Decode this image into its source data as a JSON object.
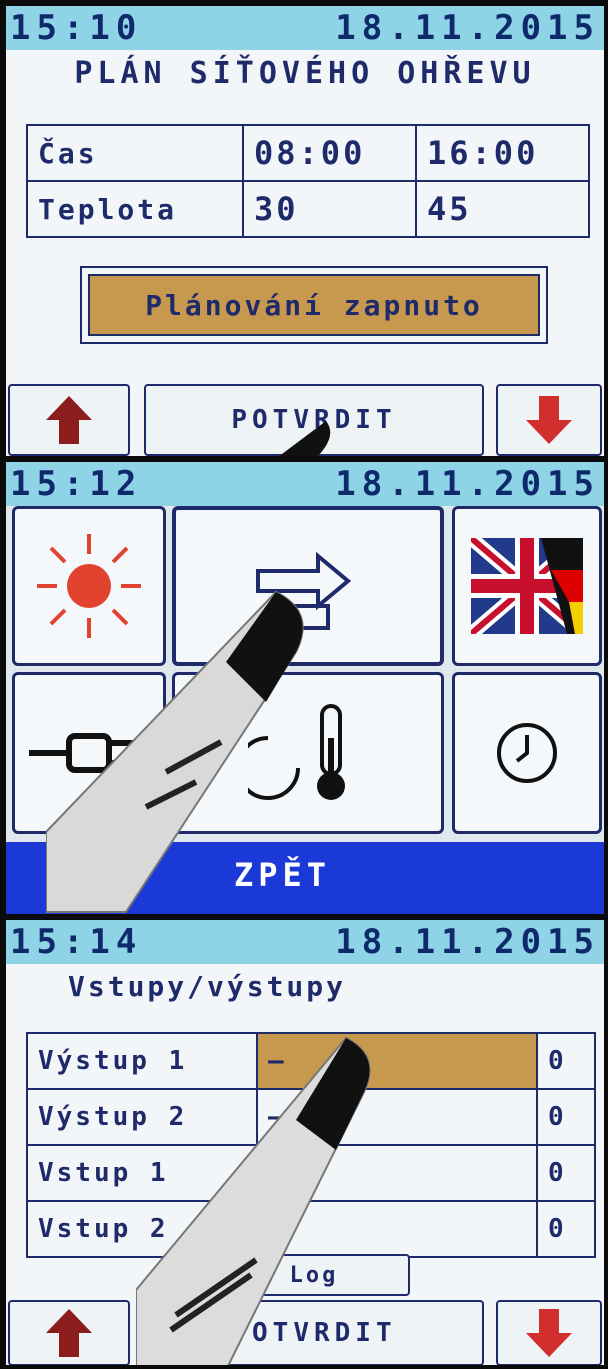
{
  "screen1": {
    "time": "15:10",
    "date": "18.11.2015",
    "title": "PLÁN SÍŤOVÉHO OHŘEVU",
    "rows": [
      {
        "label": "Čas",
        "v1": "08:00",
        "v2": "16:00"
      },
      {
        "label": "Teplota",
        "v1": "30",
        "v2": "45"
      }
    ],
    "status_button": "Plánování zapnuto",
    "confirm": "POTVRDIT"
  },
  "screen2": {
    "time": "15:12",
    "date": "18.11.2015",
    "back": "ZPĚT",
    "icons": [
      "sun-icon",
      "transfer-arrows-icon",
      "flag-icon",
      "plug-icon",
      "thermometer-icon",
      "clock-icon"
    ]
  },
  "screen3": {
    "time": "15:14",
    "date": "18.11.2015",
    "title": "Vstupy/výstupy",
    "rows": [
      {
        "label": "Výstup 1",
        "value": "–",
        "count": "0"
      },
      {
        "label": "Výstup 2",
        "value": "–",
        "count": "0"
      },
      {
        "label": "Vstup 1",
        "value": "",
        "count": "0"
      },
      {
        "label": "Vstup 2",
        "value": "",
        "count": "0"
      }
    ],
    "log_button": "Log",
    "confirm": "POTVRDIT"
  },
  "colors": {
    "status_bar": "#8ed3e6",
    "text": "#1f2a6b",
    "accent_tan": "#c7994f",
    "back_bar": "#1b39d6",
    "arrow_up": "#8b1d1d",
    "arrow_down": "#d22e2e",
    "sun": "#e2432f"
  }
}
